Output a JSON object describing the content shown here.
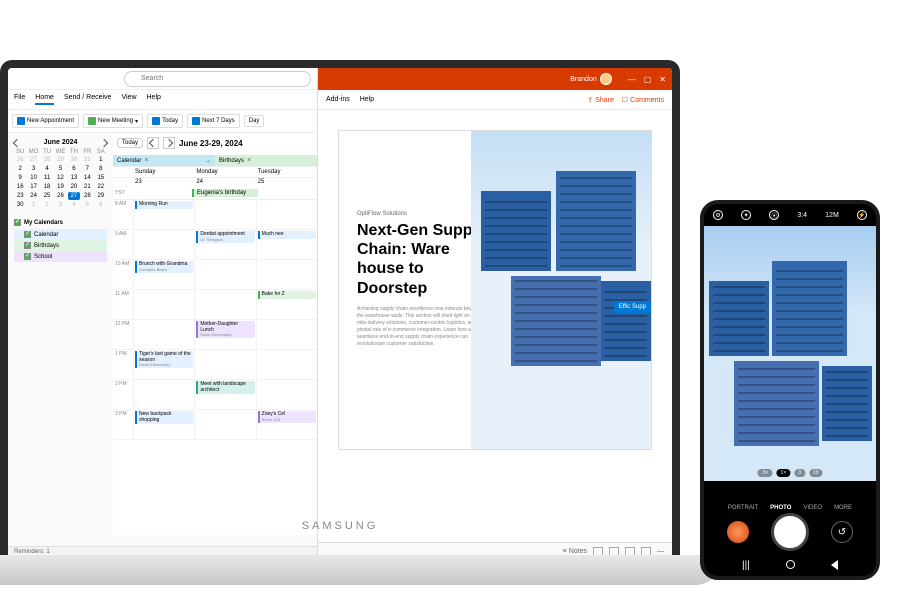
{
  "laptop_brand": "SAMSUNG",
  "outlook": {
    "search_placeholder": "Search",
    "menu": [
      "File",
      "Home",
      "Send / Receive",
      "View",
      "Help"
    ],
    "toolbar": {
      "new_appointment": "New Appointment",
      "new_meeting": "New Meeting",
      "today": "Today",
      "next7": "Next 7 Days",
      "day": "Day"
    },
    "minical": {
      "month": "June 2024",
      "dow": [
        "SU",
        "MO",
        "TU",
        "WE",
        "TH",
        "FR",
        "SA"
      ],
      "days": [
        {
          "n": 26,
          "fade": true
        },
        {
          "n": 27,
          "fade": true
        },
        {
          "n": 28,
          "fade": true
        },
        {
          "n": 29,
          "fade": true
        },
        {
          "n": 30,
          "fade": true
        },
        {
          "n": 31,
          "fade": true
        },
        {
          "n": 1
        },
        {
          "n": 2
        },
        {
          "n": 3
        },
        {
          "n": 4
        },
        {
          "n": 5
        },
        {
          "n": 6
        },
        {
          "n": 7
        },
        {
          "n": 8
        },
        {
          "n": 9
        },
        {
          "n": 10
        },
        {
          "n": 11
        },
        {
          "n": 12
        },
        {
          "n": 13
        },
        {
          "n": 14
        },
        {
          "n": 15
        },
        {
          "n": 16
        },
        {
          "n": 17
        },
        {
          "n": 18
        },
        {
          "n": 19
        },
        {
          "n": 20
        },
        {
          "n": 21
        },
        {
          "n": 22
        },
        {
          "n": 23
        },
        {
          "n": 24
        },
        {
          "n": 25
        },
        {
          "n": 26
        },
        {
          "n": 27,
          "today": true
        },
        {
          "n": 28
        },
        {
          "n": 29
        },
        {
          "n": 30
        },
        {
          "n": 1,
          "fade": true
        },
        {
          "n": 2,
          "fade": true
        },
        {
          "n": 3,
          "fade": true
        },
        {
          "n": 4,
          "fade": true
        },
        {
          "n": 5,
          "fade": true
        },
        {
          "n": 6,
          "fade": true
        }
      ]
    },
    "my_calendars_label": "My Calendars",
    "calendars": [
      {
        "name": "Calendar",
        "color": "blue"
      },
      {
        "name": "Birthdays",
        "color": "green"
      },
      {
        "name": "School",
        "color": "purple"
      }
    ],
    "grid": {
      "today_btn": "Today",
      "range": "June 23-29, 2024",
      "tabs": [
        {
          "label": "Calendar",
          "cls": "a"
        },
        {
          "label": "Birthdays",
          "cls": "b"
        }
      ],
      "day_headers": [
        "Sunday",
        "Monday",
        "Tuesday"
      ],
      "day_numbers": [
        "23",
        "24",
        "25"
      ],
      "allday_label": "YST",
      "allday_event": "Eugenia's birthday",
      "hours": [
        "8 AM",
        "9 AM",
        "10 AM",
        "11 AM",
        "12 PM",
        "1 PM",
        "2 PM",
        "3 PM"
      ],
      "events": {
        "r0c0": {
          "title": "Morning Run",
          "cls": "blue"
        },
        "r1c1": {
          "title": "Dentist appointment",
          "sub": "Dr. Selegson",
          "cls": "blue"
        },
        "r1c2": {
          "title": "Much nee",
          "cls": "blue"
        },
        "r2c0": {
          "title": "Brunch with Grandma",
          "sub": "Goodall's Bistro",
          "cls": "blue"
        },
        "r3c2": {
          "title": "Bake for Z",
          "cls": "green"
        },
        "r4c1": {
          "title": "Mother-Daughter Lunch",
          "sub": "Davis Elementary",
          "cls": "purple"
        },
        "r5c0": {
          "title": "Tiger's last game of the season",
          "sub": "Davis Elementary",
          "cls": "blue"
        },
        "r6c1": {
          "title": "Meet with landscape architect",
          "cls": "teal"
        },
        "r7c0": {
          "title": "New backpack shopping",
          "cls": "blue"
        },
        "r7c2": {
          "title": "Zoey's Cel",
          "sub": "Room 103",
          "cls": "purple"
        }
      }
    },
    "status": "Reminders: 1"
  },
  "ppt": {
    "user": "Brandon",
    "menu_l": [
      "Add-ins",
      "Help"
    ],
    "share": "Share",
    "comments": "Comments",
    "slide": {
      "kicker": "OptiFlow Solutions",
      "heading": "Next-Gen Supply Chain: Ware house to Doorstep",
      "body": "Achieving supply chain excellence now extends beyond the warehouse walls. This section will shed light on last-mile delivery solutions, customer-centric logistics, and the pivotal role of e-commerce integration. Learn how a seamless end-to-end supply chain experience can revolutionize customer satisfaction.",
      "badge": "Effic\nSupp"
    },
    "notes": "Notes"
  },
  "phone": {
    "status_items": [
      "⚙",
      "✦",
      "⦿",
      "3:4",
      "12M",
      "⚡"
    ],
    "modes": [
      "PORTRAIT",
      "PHOTO",
      "VIDEO",
      "MORE"
    ],
    "zoom": [
      ".5×",
      "1×",
      "3",
      "10"
    ]
  }
}
